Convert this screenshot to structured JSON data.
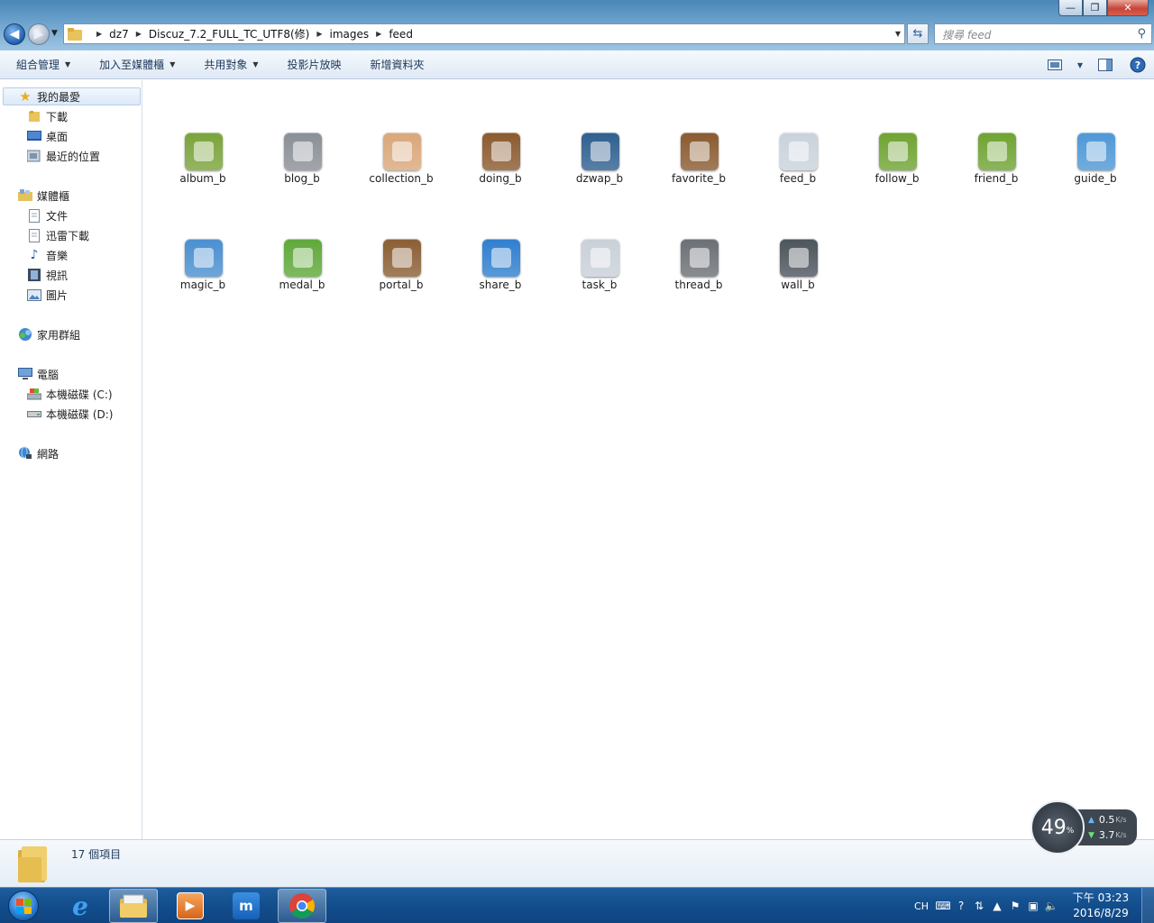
{
  "window": {
    "minimize_label": "—",
    "maximize_label": "❐",
    "close_label": "✕"
  },
  "address": {
    "crumbs": [
      "dz7",
      "Discuz_7.2_FULL_TC_UTF8(修)",
      "images",
      "feed"
    ]
  },
  "search": {
    "placeholder": "搜尋 feed"
  },
  "toolbar": {
    "organize": "組合管理",
    "include_library": "加入至媒體櫃",
    "share_with": "共用對象",
    "slideshow": "投影片放映",
    "new_folder": "新增資料夾"
  },
  "nav": {
    "favorites": "我的最愛",
    "downloads": "下載",
    "desktop": "桌面",
    "recent": "最近的位置",
    "libraries": "媒體櫃",
    "documents": "文件",
    "thunder": "迅雷下載",
    "music": "音樂",
    "videos": "視訊",
    "pictures": "圖片",
    "homegroup": "家用群組",
    "computer": "電腦",
    "drive_c": "本機磁碟 (C:)",
    "drive_d": "本機磁碟 (D:)",
    "network": "網路"
  },
  "files": [
    {
      "name": "album_b",
      "color": "#7aa33a"
    },
    {
      "name": "blog_b",
      "color": "#8a8f96"
    },
    {
      "name": "collection_b",
      "color": "#d9a77a"
    },
    {
      "name": "doing_b",
      "color": "#8a5a2e"
    },
    {
      "name": "dzwap_b",
      "color": "#2f5f8f"
    },
    {
      "name": "favorite_b",
      "color": "#8a5a30"
    },
    {
      "name": "feed_b",
      "color": "#c9d2dc"
    },
    {
      "name": "follow_b",
      "color": "#6fa332"
    },
    {
      "name": "friend_b",
      "color": "#6fa332"
    },
    {
      "name": "guide_b",
      "color": "#4f97d6"
    },
    {
      "name": "magic_b",
      "color": "#4a8fd0"
    },
    {
      "name": "medal_b",
      "color": "#5fa83a"
    },
    {
      "name": "portal_b",
      "color": "#8a5e34"
    },
    {
      "name": "share_b",
      "color": "#2f7fcf"
    },
    {
      "name": "task_b",
      "color": "#c9d0d8"
    },
    {
      "name": "thread_b",
      "color": "#6b7076"
    },
    {
      "name": "wall_b",
      "color": "#4c545c"
    }
  ],
  "status": {
    "item_count": "17 個項目"
  },
  "widget": {
    "cpu": "49",
    "cpu_unit": "%",
    "upload": "0.5",
    "download": "3.7",
    "rate_unit": "K/s"
  },
  "taskbar": {
    "lang": "CH",
    "time": "下午 03:23",
    "date": "2016/8/29"
  }
}
